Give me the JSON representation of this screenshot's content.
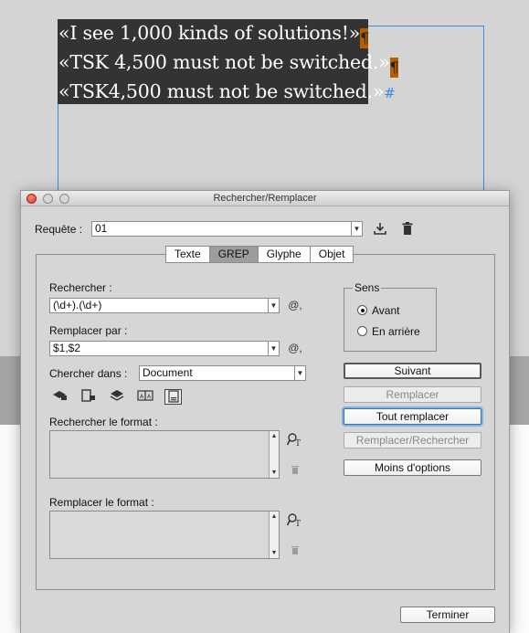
{
  "document": {
    "lines": [
      {
        "text": "«I see 1,000 kinds of solutions!»",
        "end": "pilcrow"
      },
      {
        "text": "«TSK 4,500 must not be switched.»",
        "end": "pilcrow"
      },
      {
        "text": "«TSK4,500 must not be switched.»",
        "end": "hash"
      }
    ],
    "pilcrow_glyph": "¶",
    "hash_glyph": "#"
  },
  "dialog": {
    "title": "Rechercher/Remplacer",
    "query_label": "Requête :",
    "query_value": "01",
    "tabs": [
      {
        "label": "Texte",
        "active": false
      },
      {
        "label": "GREP",
        "active": true
      },
      {
        "label": "Glyphe",
        "active": false
      },
      {
        "label": "Objet",
        "active": false
      }
    ],
    "find_label": "Rechercher :",
    "find_value": "(\\d+).(\\d+)",
    "replace_label": "Remplacer par :",
    "replace_value": "$1,$2",
    "search_in_label": "Chercher dans :",
    "search_in_value": "Document",
    "find_format_label": "Rechercher le format :",
    "replace_format_label": "Remplacer le format :",
    "direction": {
      "legend": "Sens",
      "options": [
        {
          "label": "Avant",
          "selected": true
        },
        {
          "label": "En arrière",
          "selected": false
        }
      ]
    },
    "buttons": {
      "next": "Suivant",
      "replace": "Remplacer",
      "replace_all": "Tout remplacer",
      "replace_find": "Remplacer/Rechercher",
      "fewer_options": "Moins d'options",
      "done": "Terminer"
    },
    "special_char_glyph": "@,",
    "dropdown_glyph": "▼"
  },
  "colors": {
    "text_frame": "#3a8de0",
    "selection": "#333333",
    "pilcrow": "#e08a1e"
  }
}
